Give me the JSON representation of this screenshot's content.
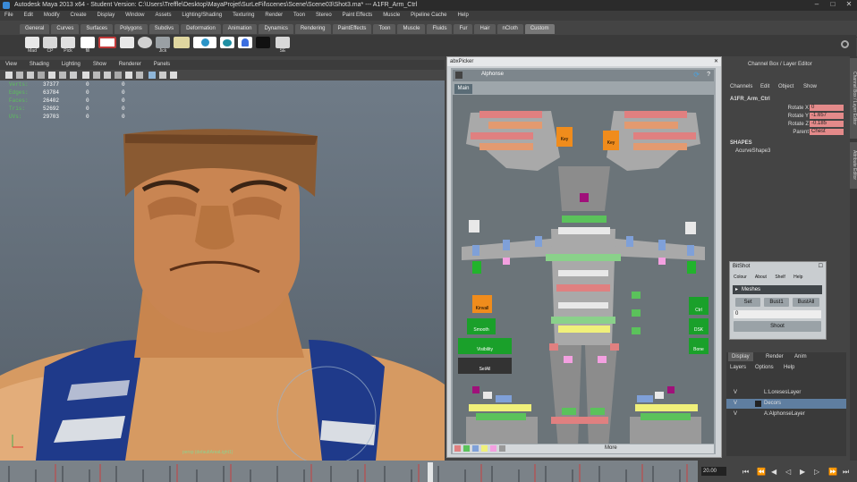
{
  "window": {
    "title": "Autodesk Maya 2013 x64 - Student Version: C:\\Users\\Treffle\\Desktop\\MayaProjet\\SurLeFil\\scenes\\Scene\\Scene03\\Shot3.ma* --- A1FR_Arm_Ctrl"
  },
  "menubar": {
    "items": [
      "File",
      "Edit",
      "Modify",
      "Create",
      "Display",
      "Window",
      "Assets",
      "Lighting/Shading",
      "Texturing",
      "Render",
      "Toon",
      "Stereo",
      "Paint Effects",
      "Muscle",
      "Pipeline Cache",
      "Help"
    ]
  },
  "shelf": {
    "tabs": [
      "General",
      "Curves",
      "Surfaces",
      "Polygons",
      "Subdivs",
      "Deformation",
      "Animation",
      "Dynamics",
      "Rendering",
      "PaintEffects",
      "Toon",
      "Muscle",
      "Fluids",
      "Fur",
      "Hair",
      "nCloth",
      "Custom"
    ],
    "active_tab": "Custom",
    "tools": [
      {
        "label": "Mad",
        "icon": "mad-tool-icon",
        "color": "#e8e8e8"
      },
      {
        "label": "CP",
        "icon": "cp-tool-icon",
        "color": "#d8d8d8"
      },
      {
        "label": "Pick",
        "icon": "pick-tool-icon",
        "color": "#e0e0e0"
      },
      {
        "label": "fill",
        "icon": "fill-tool-icon",
        "color": "#ffffff"
      },
      {
        "label": "",
        "icon": "red-swatch-icon",
        "color": "#c23b3b"
      },
      {
        "label": "",
        "icon": "shape-icon",
        "color": "#e8e8e8"
      },
      {
        "label": "",
        "icon": "sphere-icon",
        "color": "#d0d0d0"
      },
      {
        "label": "Jick",
        "icon": "jick-tool-icon",
        "color": "#9aa0a4"
      },
      {
        "label": "",
        "icon": "paint-icon",
        "color": "#e0d7a0"
      },
      {
        "label": "",
        "icon": "eye-blue-icon",
        "color": "#2a94c8"
      },
      {
        "label": "",
        "icon": "teal-blob-icon",
        "color": "#1f8fa3"
      },
      {
        "label": "",
        "icon": "ghost-icon",
        "color": "#3a6ee0"
      },
      {
        "label": "",
        "icon": "pacman-icon",
        "color": "#111111"
      },
      {
        "label": "SE",
        "icon": "se-tool-icon",
        "color": "#d8d8d8"
      }
    ]
  },
  "viewport": {
    "menu": [
      "View",
      "Shading",
      "Lighting",
      "Show",
      "Renderer",
      "Panels"
    ],
    "stats": [
      {
        "label": "Verts:",
        "v1": "37377",
        "v2": "0",
        "v3": "0"
      },
      {
        "label": "Edges:",
        "v1": "63784",
        "v2": "0",
        "v3": "0"
      },
      {
        "label": "Faces:",
        "v1": "26402",
        "v2": "0",
        "v3": "0"
      },
      {
        "label": "Tris:",
        "v1": "52692",
        "v2": "0",
        "v3": "0"
      },
      {
        "label": "UVs:",
        "v1": "29703",
        "v2": "0",
        "v3": "0"
      }
    ],
    "camera_label": "persp (defaultAreaLight1)"
  },
  "picker": {
    "title": "abxPicker",
    "character": "Alphonse",
    "tab": "Main",
    "labels": {
      "key_left": "Key",
      "key_right": "Key",
      "kinvall": "Kinvall",
      "smooth": "Smooth",
      "visibility": "Visibility",
      "selall": "SelAll",
      "ctrl": "Ctrl",
      "dsk": "DSK",
      "bone": "Bone"
    },
    "footer": "More"
  },
  "channel_box": {
    "title": "Channel Box / Layer Editor",
    "menu": [
      "Channels",
      "Edit",
      "Object",
      "Show"
    ],
    "object": "A1FR_Arm_Ctrl",
    "channels": [
      {
        "name": "Rotate X",
        "value": "0"
      },
      {
        "name": "Rotate Y",
        "value": "-1.657"
      },
      {
        "name": "Rotate Z",
        "value": "-0.185"
      },
      {
        "name": "Parent",
        "value": "Chest"
      }
    ],
    "shapes_header": "SHAPES",
    "shape": "AcurveShape3"
  },
  "side_tabs": [
    "Channel Box / Layer Editor",
    "Attribute Editor"
  ],
  "bitshot": {
    "title": "BitShot",
    "menu": [
      "Colour",
      "About",
      "Shelf",
      "Help"
    ],
    "section": "Meshes",
    "buttons": [
      "Set",
      "Bust1",
      "BustAll"
    ],
    "field": "0",
    "shoot": "Shoot"
  },
  "layer_editor": {
    "tabs": [
      "Display",
      "Render",
      "Anim"
    ],
    "menu": [
      "Layers",
      "Options",
      "Help"
    ],
    "layers": [
      {
        "v": "V",
        "name": "L:LoresesLayer",
        "selected": false
      },
      {
        "v": "V",
        "name": "Decors",
        "selected": true
      },
      {
        "v": "V",
        "name": "A:AlphonseLayer",
        "selected": false
      }
    ]
  },
  "timeline": {
    "current_frame": "20.00",
    "colors": {
      "accent": "#c84040",
      "track": "#7b8288"
    }
  }
}
